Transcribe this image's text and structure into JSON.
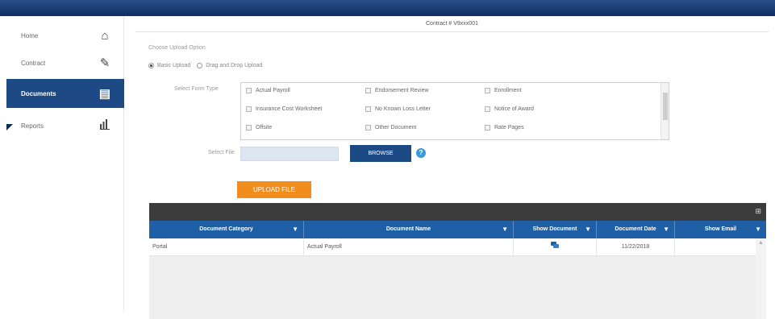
{
  "sidebar": {
    "items": [
      {
        "label": "Home",
        "icon": "home-icon",
        "glyph": "⌂",
        "active": false
      },
      {
        "label": "Contract",
        "icon": "pencil-icon",
        "glyph": "✎",
        "active": false
      },
      {
        "label": "Documents",
        "icon": "document-icon",
        "glyph": "▤",
        "active": true
      },
      {
        "label": "Reports",
        "icon": "bar-chart-icon",
        "glyph": "▮",
        "active": false
      }
    ]
  },
  "header": {
    "contract_label": "Contract # V9xxx001"
  },
  "upload": {
    "option_label": "Choose Upload Option",
    "basic_label": "Basic Upload",
    "dragdrop_label": "Drag and Drop Upload",
    "form_type_label": "Select Form Type",
    "form_types": [
      "Actual Payroll",
      "Endorsement Review",
      "Enrollment",
      "Insurance Cost Worksheet",
      "No Known Loss Letter",
      "Notice of Award",
      "Offsite",
      "Other Document",
      "Rate Pages"
    ],
    "file_label": "Select File",
    "file_value": "",
    "browse_label": "BROWSE",
    "help_glyph": "?",
    "upload_button": "UPLOAD FILE"
  },
  "grid": {
    "toolbar_icon": "⊞",
    "columns": [
      "Document Category",
      "Document Name",
      "Show Document",
      "Document Date",
      "Show Email"
    ],
    "filter_glyph": "▼",
    "rows": [
      {
        "category": "Portal",
        "name": "Actual Payroll",
        "show_document": "",
        "date": "11/22/2018",
        "show_email": ""
      }
    ]
  },
  "colors": {
    "accent": "#1d4a85",
    "header": "#1f5fa6",
    "upload": "#f08d1d"
  }
}
